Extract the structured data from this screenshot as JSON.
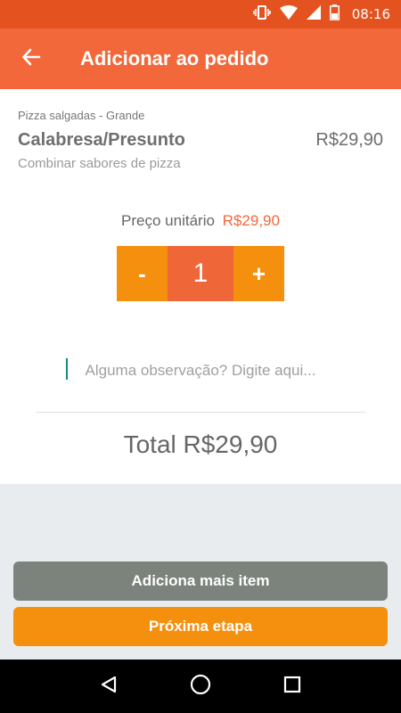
{
  "status_bar": {
    "time": "08:16",
    "icons": [
      "vibrate-icon",
      "wifi-icon",
      "signal-icon",
      "battery-icon"
    ]
  },
  "app_bar": {
    "back_icon": "arrow-left-icon",
    "title": "Adicionar ao pedido"
  },
  "product": {
    "category": "Pizza salgadas - Grande",
    "name": "Calabresa/Presunto",
    "price": "R$29,90",
    "subtitle": "Combinar sabores de pizza"
  },
  "unit": {
    "label": "Preço unitário",
    "price": "R$29,90"
  },
  "stepper": {
    "minus_label": "-",
    "quantity": "1",
    "plus_label": "+"
  },
  "observation": {
    "placeholder": "Alguma observação? Digite aqui...",
    "value": ""
  },
  "total": {
    "label": "Total R$29,90"
  },
  "buttons": {
    "add_more": "Adiciona mais item",
    "next_step": "Próxima etapa"
  },
  "nav_bar": {
    "icons": [
      "back-triangle-icon",
      "home-circle-icon",
      "recents-square-icon"
    ]
  },
  "colors": {
    "status_bar": "#e4531f",
    "app_bar": "#f2683a",
    "accent_orange": "#f5900e",
    "quantity_bg": "#ef6638",
    "secondary_button": "#7b837c",
    "price_accent": "#f2683a"
  }
}
